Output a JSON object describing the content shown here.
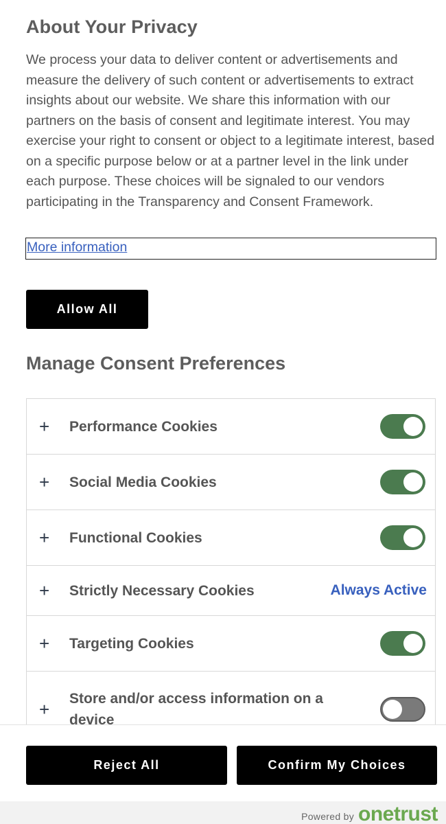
{
  "privacy": {
    "title": "About Your Privacy",
    "description": "We process your data to deliver content or advertisements and measure the delivery of such content or advertisements to extract insights about our website. We share this information with our partners on the basis of consent and legitimate interest. You may exercise your right to consent or object to a legitimate interest, based on a specific purpose below or at a partner level in the link under each purpose. These choices will be signaled to our vendors participating in the Transparency and Consent Framework.",
    "more_info_link": "More information",
    "allow_all_label": "Allow All"
  },
  "manage": {
    "title": "Manage Consent Preferences",
    "expand_icon": "plus-icon",
    "categories": [
      {
        "label": "Performance Cookies",
        "state": "on"
      },
      {
        "label": "Social Media Cookies",
        "state": "on"
      },
      {
        "label": "Functional Cookies",
        "state": "on"
      },
      {
        "label": "Strictly Necessary Cookies",
        "state": "always",
        "status_text": "Always Active"
      },
      {
        "label": "Targeting Cookies",
        "state": "on"
      },
      {
        "label": "Store and/or access information on a device",
        "state": "off"
      }
    ]
  },
  "footer": {
    "reject_all_label": "Reject All",
    "confirm_label": "Confirm My Choices",
    "powered_by": "Powered by",
    "brand": "onetrust"
  },
  "colors": {
    "toggle_on": "#4b7b4f",
    "toggle_off": "#7a7a7a",
    "link": "#3860be",
    "button": "#000000",
    "brand": "#6aa84f"
  }
}
